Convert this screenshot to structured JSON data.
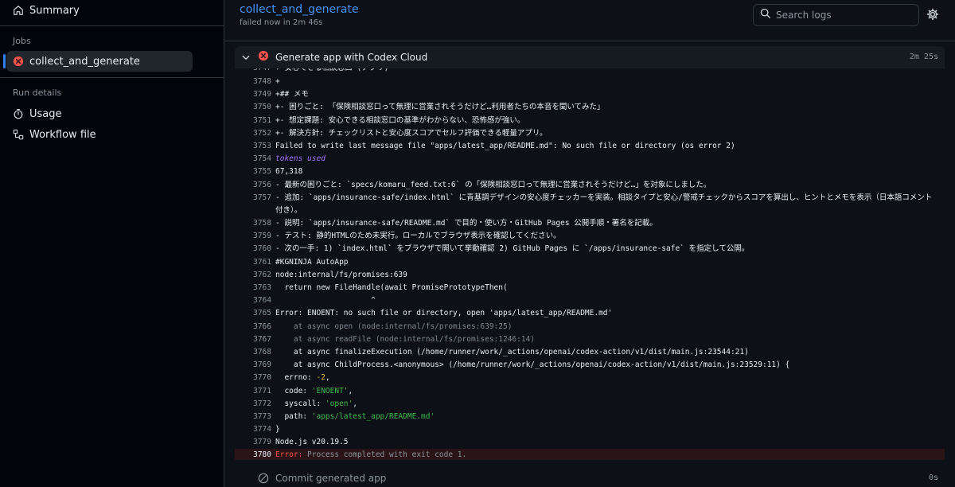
{
  "sidebar": {
    "summary_label": "Summary",
    "jobs_heading": "Jobs",
    "job_label": "collect_and_generate",
    "run_details_heading": "Run details",
    "usage_label": "Usage",
    "workflow_label": "Workflow file"
  },
  "header": {
    "title": "collect_and_generate",
    "subtitle": "failed now in 2m 46s",
    "search_placeholder": "Search logs"
  },
  "step": {
    "title": "Generate app with Codex Cloud",
    "duration": "2m 25s"
  },
  "log_lines": [
    {
      "n": "3747",
      "t": "+ 安心できる相談窓口 (アプリ)"
    },
    {
      "n": "3748",
      "t": "+"
    },
    {
      "n": "3749",
      "t": "+## メモ"
    },
    {
      "n": "3750",
      "t": "+- 困りごと: 「保険相談窓口って無理に営業されそうだけど…利用者たちの本音を聞いてみた」"
    },
    {
      "n": "3751",
      "t": "+- 想定課題: 安心できる相談窓口の基準がわからない、恐怖感が強い。"
    },
    {
      "n": "3752",
      "t": "+- 解決方針: チェックリストと安心度スコアでセルフ評価できる軽量アプリ。"
    },
    {
      "n": "3753",
      "t": "Failed to write last message file \"apps/latest_app/README.md\": No such file or directory (os error 2)"
    },
    {
      "n": "3754",
      "t": "tokens used"
    },
    {
      "n": "3755",
      "t": "67,318"
    },
    {
      "n": "3756",
      "t": "- 最新の困りごと: `specs/komaru_feed.txt:6` の「保険相談窓口って無理に営業されそうだけど…」を対象にしました。"
    },
    {
      "n": "3757",
      "t": "- 追加: `apps/insurance-safe/index.html` に青基調デザインの安心度チェッカーを実装。相談タイプと安心/警戒チェックからスコアを算出し、ヒントとメモを表示（日本語コメント付き）。"
    },
    {
      "n": "3758",
      "t": "- 説明: `apps/insurance-safe/README.md` で目的・使い方・GitHub Pages 公開手順・署名を記載。"
    },
    {
      "n": "3759",
      "t": "- テスト: 静的HTMLのため未実行。ローカルでブラウザ表示を確認してください。"
    },
    {
      "n": "3760",
      "t": "- 次の一手: 1) `index.html` をブラウザで開いて挙動確認 2) GitHub Pages に `/apps/insurance-safe` を指定して公開。"
    },
    {
      "n": "3761",
      "t": "#KGNINJA AutoApp"
    },
    {
      "n": "3762",
      "t": "node:internal/fs/promises:639"
    },
    {
      "n": "3763",
      "t": "  return new FileHandle(await PromisePrototypeThen("
    },
    {
      "n": "3764",
      "t": "                     ^"
    },
    {
      "n": "3765",
      "t": "Error: ENOENT: no such file or directory, open 'apps/latest_app/README.md'"
    },
    {
      "n": "3766",
      "t": "    at async open (node:internal/fs/promises:639:25)"
    },
    {
      "n": "3767",
      "t": "    at async readFile (node:internal/fs/promises:1246:14)"
    },
    {
      "n": "3768",
      "t": "    at async finalizeExecution (/home/runner/work/_actions/openai/codex-action/v1/dist/main.js:23544:21)"
    },
    {
      "n": "3769",
      "t": "    at async ChildProcess.<anonymous> (/home/runner/work/_actions/openai/codex-action/v1/dist/main.js:23529:11) {"
    },
    {
      "n": "3770",
      "t": "  errno: ",
      "v": "-2",
      "tail": ","
    },
    {
      "n": "3771",
      "t": "  code: ",
      "v": "'ENOENT'",
      "tail": ","
    },
    {
      "n": "3772",
      "t": "  syscall: ",
      "v": "'open'",
      "tail": ","
    },
    {
      "n": "3773",
      "t": "  path: ",
      "v": "'apps/latest_app/README.md'",
      "tail": ""
    },
    {
      "n": "3774",
      "t": "}"
    },
    {
      "n": "3779",
      "t": "Node.js v20.19.5"
    },
    {
      "n": "3780",
      "t": "Error:",
      "rest": " Process completed with exit code 1."
    }
  ],
  "next_step": {
    "title": "Commit generated app",
    "duration": "0s"
  },
  "colors": {
    "accent": "#4493f8",
    "error": "#f85149",
    "warning": "#e3b341",
    "success": "#3fb950"
  }
}
